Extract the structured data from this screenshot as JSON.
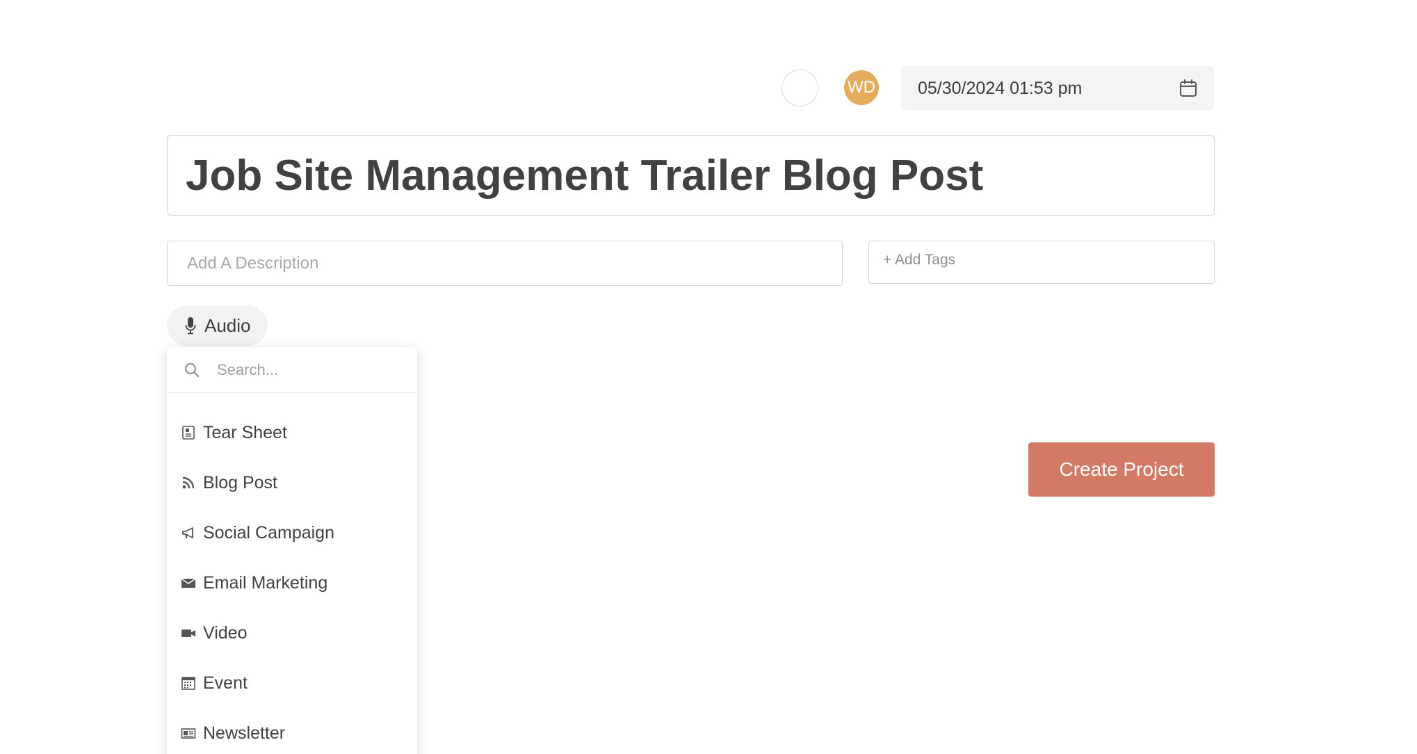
{
  "header": {
    "avatar_initials": "WD",
    "avatar_color": "#e4ac5d",
    "date_value": "05/30/2024 01:53 pm",
    "calendar_icon": "calendar-icon"
  },
  "project": {
    "title": "Job Site Management Trailer Blog Post",
    "description_placeholder": "Add A Description",
    "tags_placeholder": "+ Add Tags"
  },
  "type_selector": {
    "selected_label": "Audio",
    "selected_icon": "microphone-icon",
    "search_placeholder": "Search...",
    "options": [
      {
        "label": "Tear Sheet",
        "icon": "document-icon"
      },
      {
        "label": "Blog Post",
        "icon": "rss-icon"
      },
      {
        "label": "Social Campaign",
        "icon": "megaphone-icon"
      },
      {
        "label": "Email Marketing",
        "icon": "envelope-icon"
      },
      {
        "label": "Video",
        "icon": "video-camera-icon"
      },
      {
        "label": "Event",
        "icon": "calendar-grid-icon"
      },
      {
        "label": "Newsletter",
        "icon": "newspaper-icon"
      }
    ]
  },
  "actions": {
    "create_label": "Create Project",
    "create_color": "#d37a66"
  }
}
